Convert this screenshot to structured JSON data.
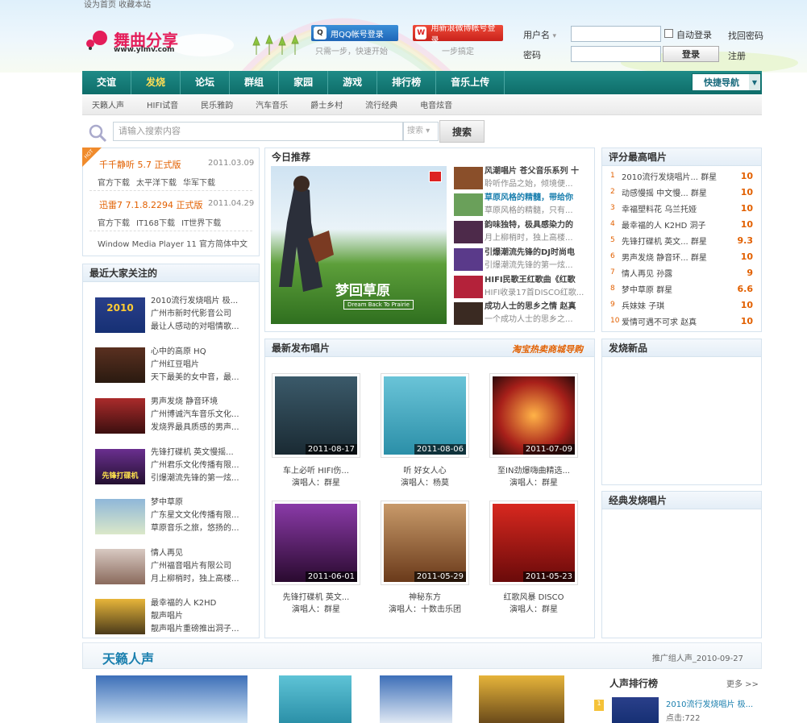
{
  "site": {
    "top_links": "设为首页  收藏本站",
    "logo_text": "舞曲分享",
    "logo_url": "www.ylmv.com"
  },
  "login": {
    "qq_label": "用QQ帐号登录",
    "qq_tip": "只需一步，快速开始",
    "weibo_label": "用新浪微博帐号登录",
    "weibo_tip": "一步搞定",
    "username_label": "用户名",
    "password_label": "密码",
    "auto_login_label": "自动登录",
    "forgot_label": "找回密码",
    "login_button": "登录",
    "register_link": "注册"
  },
  "nav": {
    "items": [
      "交谊",
      "发烧",
      "论坛",
      "群组",
      "家园",
      "游戏",
      "排行榜",
      "音乐上传"
    ],
    "quick_nav": "快捷导航"
  },
  "subnav": {
    "items": [
      "天籁人声",
      "HIFI试音",
      "民乐雅韵",
      "汽车音乐",
      "爵士乡村",
      "流行经典",
      "电音炫音"
    ]
  },
  "search": {
    "placeholder": "请输入搜索内容",
    "select_label": "搜索",
    "button": "搜索"
  },
  "downloads": [
    {
      "title": "千千静听 5.7 正式版",
      "date": "2011.03.09",
      "links": [
        "官方下载",
        "太平洋下载",
        "华军下载"
      ]
    },
    {
      "title": "迅雷7 7.1.8.2294 正式版",
      "date": "2011.04.29",
      "links": [
        "官方下载",
        "IT168下载",
        "IT世界下载"
      ]
    },
    {
      "title": "Window Media Player 11 官方简体中文",
      "date": "",
      "links": []
    }
  ],
  "recent_focus": {
    "title": "最近大家关注的",
    "items": [
      {
        "title": "2010流行发烧唱片 极...",
        "company": "广州市新时代影音公司",
        "desc": "最让人感动的对唱情歌...",
        "cover_text": "2010"
      },
      {
        "title": "心中的高原 HQ",
        "company": "广州红豆唱片",
        "desc": "天下最美的女中音，最...",
        "cover_text": ""
      },
      {
        "title": "男声发烧 静音环境",
        "company": "广州博诚汽车音乐文化...",
        "desc": "发烧界最具质感的男声...",
        "cover_text": ""
      },
      {
        "title": "先锋打碟机 英文慢摇...",
        "company": "广州君乐文化传播有限...",
        "desc": "引爆潮流先锋的第一炫...",
        "cover_text": "先锋打碟机"
      },
      {
        "title": "梦中草原",
        "company": "广东星文文化传播有限...",
        "desc": "草原音乐之旅，悠扬的...",
        "cover_text": ""
      },
      {
        "title": "情人再见",
        "company": "广州福音唱片有限公司",
        "desc": "月上柳梢时，独上高楼...",
        "cover_text": ""
      },
      {
        "title": "最幸福的人 K2HD",
        "company": "靓声唱片",
        "desc": "靓声唱片重磅推出洞子...",
        "cover_text": ""
      }
    ]
  },
  "today": {
    "title": "今日推荐",
    "feature_title": "梦回草原",
    "feature_sub": "Dream Back To Prairie",
    "items": [
      {
        "title": "风潮唱片 苍父音乐系列 十",
        "desc": "聆听作品之始，倾境便..."
      },
      {
        "title": "草原风格的精髓，带给你",
        "desc": "草原风格的精髓，只有..."
      },
      {
        "title": "韵味独特，极具感染力的",
        "desc": "月上柳梢时，独上高楼..."
      },
      {
        "title": "引爆潮流先锋的DJ时尚电",
        "desc": "引爆潮流先锋的第一炫..."
      },
      {
        "title": "HIFI民歌王红歌曲《红歌",
        "desc": "HIFI收录17首DISCO红歌..."
      },
      {
        "title": "成功人士的思乡之情 赵真",
        "desc": "一个成功人士的思乡之..."
      }
    ]
  },
  "new_releases": {
    "title": "最新发布唱片",
    "promo": "淘宝热卖商城导购",
    "albums": [
      {
        "date": "2011-08-17",
        "title": "车上必听 HIFI伤...",
        "artist": "演唱人：群星"
      },
      {
        "date": "2011-08-06",
        "title": "听 好女人心",
        "artist": "演唱人：杨莫"
      },
      {
        "date": "2011-07-09",
        "title": "至IN劲爆嗨曲精选...",
        "artist": "演唱人：群星"
      },
      {
        "date": "2011-06-01",
        "title": "先锋打碟机 英文...",
        "artist": "演唱人：群星"
      },
      {
        "date": "2011-05-29",
        "title": "神秘东方",
        "artist": "演唱人：十数击乐团"
      },
      {
        "date": "2011-05-23",
        "title": "红歌风暴 DISCO",
        "artist": "演唱人：群星"
      }
    ]
  },
  "top_rated": {
    "title": "评分最高唱片",
    "items": [
      {
        "n": "1",
        "title": "2010流行发烧唱片...",
        "artist": "群星",
        "score": "10"
      },
      {
        "n": "2",
        "title": "动感慢摇 中文慢...",
        "artist": "群星",
        "score": "10"
      },
      {
        "n": "3",
        "title": "幸福塑料花",
        "artist": "乌兰托娅",
        "score": "10"
      },
      {
        "n": "4",
        "title": "最幸福的人 K2HD",
        "artist": "洞子",
        "score": "10"
      },
      {
        "n": "5",
        "title": "先锋打碟机 英文...",
        "artist": "群星",
        "score": "9.3"
      },
      {
        "n": "6",
        "title": "男声发烧 静音环...",
        "artist": "群星",
        "score": "10"
      },
      {
        "n": "7",
        "title": "情人再见",
        "artist": "孙露",
        "score": "9"
      },
      {
        "n": "8",
        "title": "梦中草原",
        "artist": "群星",
        "score": "6.6"
      },
      {
        "n": "9",
        "title": "兵妹妹",
        "artist": "子琪",
        "score": "10"
      },
      {
        "n": "10",
        "title": "爱情可遇不可求",
        "artist": "赵真",
        "score": "10"
      }
    ]
  },
  "hifi_new": {
    "title": "发烧新品"
  },
  "classic": {
    "title": "经典发烧唱片"
  },
  "tianlai": {
    "title": "天籁人声",
    "recommend": "推广组人声_2010-09-27",
    "rank_title": "人声排行榜",
    "more": "更多 >>",
    "rank_item_title": "2010流行发烧唱片 极...",
    "rank_item_clicks": "点击:722"
  },
  "colors": {
    "nav": "#138280",
    "accent": "#e26000",
    "link": "#1a7fae"
  }
}
